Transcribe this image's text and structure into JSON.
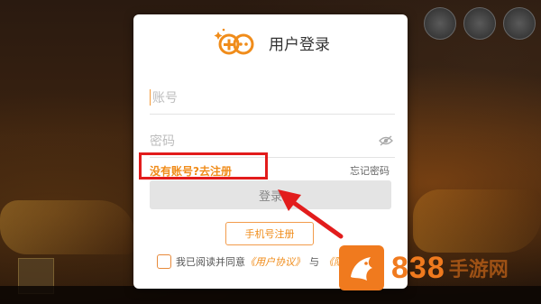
{
  "dialog": {
    "title": "用户登录",
    "account_placeholder": "账号",
    "password_placeholder": "密码",
    "register_link": "没有账号?去注册",
    "forgot_link": "忘记密码",
    "login_button": "登录",
    "phone_register_button": "手机号注册",
    "agreement": {
      "prefix": "我已阅读并同意",
      "user_agreement": "《用户协议》",
      "and": "与",
      "privacy_link": "《隐"
    }
  },
  "watermark": {
    "number": "838",
    "text": "手游网"
  },
  "icons": {
    "logo": "gamepad-icon",
    "eye": "eye-hidden-icon",
    "checkbox": "checkbox-unchecked-icon"
  },
  "colors": {
    "accent": "#f08c1a",
    "annotation": "#e21c1c",
    "login_button_bg": "#e4e4e4"
  }
}
